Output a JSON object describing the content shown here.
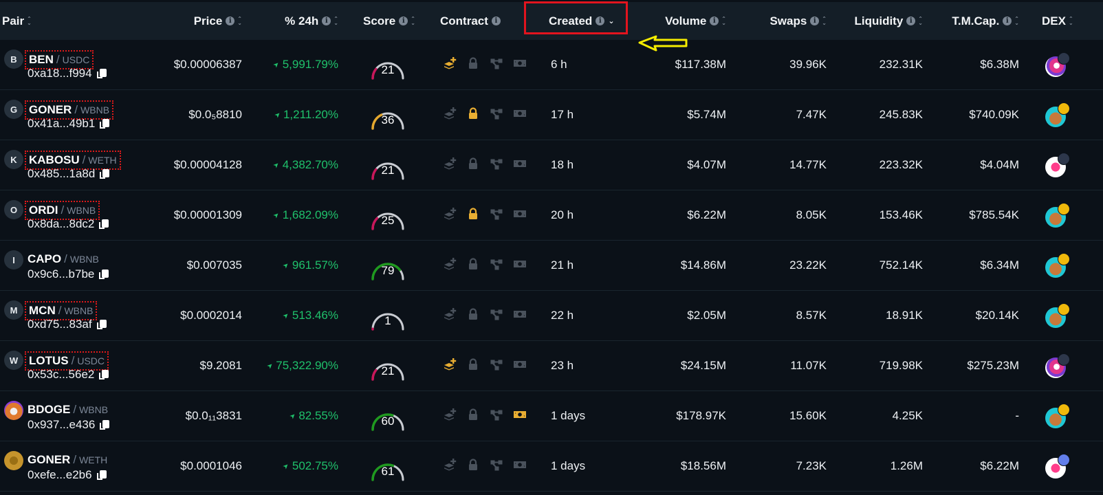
{
  "header": {
    "columns": [
      {
        "label": "Pair",
        "info": false,
        "sort": "both"
      },
      {
        "label": "Price",
        "info": true,
        "sort": "both"
      },
      {
        "label": "% 24h",
        "info": true,
        "sort": "both"
      },
      {
        "label": "Score",
        "info": true,
        "sort": "both"
      },
      {
        "label": "Contract",
        "info": true,
        "sort": "none"
      },
      {
        "label": "Created",
        "info": true,
        "sort": "desc"
      },
      {
        "label": "Volume",
        "info": true,
        "sort": "both"
      },
      {
        "label": "Swaps",
        "info": true,
        "sort": "both"
      },
      {
        "label": "Liquidity",
        "info": true,
        "sort": "both"
      },
      {
        "label": "T.M.Cap.",
        "info": true,
        "sort": "both"
      },
      {
        "label": "DEX",
        "info": false,
        "sort": "both"
      }
    ],
    "info_glyph": "i",
    "highlighted_column": "Created"
  },
  "colors": {
    "background": "#0b1118",
    "header_bg": "#141e27",
    "positive": "#1fc16b",
    "score_low": "#c8175a",
    "score_mid": "#e5a82e",
    "score_high": "#1f9a1f",
    "score_track": "#c9ccd2",
    "icon_active": "#e9ae32",
    "icon_inactive": "#4a525c",
    "annotation_red": "#e2141e",
    "annotation_yellow": "#f5ec00"
  },
  "rows": [
    {
      "avatar": "B",
      "avatar_type": "letter",
      "symbol": "BEN",
      "quote": "USDC",
      "address": "0xa18...f994",
      "dotted": true,
      "price": "$0.00006387",
      "change": "5,991.79%",
      "score": 21,
      "contract": {
        "layers": true,
        "lock": false,
        "share": false,
        "cash": false
      },
      "created": "6 h",
      "volume": "$117.38M",
      "swaps": "39.96K",
      "liquidity": "232.31K",
      "mcap": "$6.38M",
      "dex": "sushiswap",
      "chain": "arbitrum"
    },
    {
      "avatar": "G",
      "avatar_type": "letter",
      "symbol": "GONER",
      "quote": "WBNB",
      "address": "0x41a...49b1",
      "dotted": true,
      "price": "$0.0₅8810",
      "change": "1,211.20%",
      "score": 36,
      "contract": {
        "layers": false,
        "lock": true,
        "share": false,
        "cash": false
      },
      "created": "17 h",
      "volume": "$5.74M",
      "swaps": "7.47K",
      "liquidity": "245.83K",
      "mcap": "$740.09K",
      "dex": "pancakeswap",
      "chain": "bnb"
    },
    {
      "avatar": "K",
      "avatar_type": "letter",
      "symbol": "KABOSU",
      "quote": "WETH",
      "address": "0x485...1a8d",
      "dotted": true,
      "price": "$0.00004128",
      "change": "4,382.70%",
      "score": 21,
      "contract": {
        "layers": false,
        "lock": false,
        "share": false,
        "cash": false
      },
      "created": "18 h",
      "volume": "$4.07M",
      "swaps": "14.77K",
      "liquidity": "223.32K",
      "mcap": "$4.04M",
      "dex": "uniswap",
      "chain": "arbitrum"
    },
    {
      "avatar": "O",
      "avatar_type": "letter",
      "symbol": "ORDI",
      "quote": "WBNB",
      "address": "0x8da...8dc2",
      "dotted": true,
      "price": "$0.00001309",
      "change": "1,682.09%",
      "score": 25,
      "contract": {
        "layers": false,
        "lock": true,
        "share": false,
        "cash": false
      },
      "created": "20 h",
      "volume": "$6.22M",
      "swaps": "8.05K",
      "liquidity": "153.46K",
      "mcap": "$785.54K",
      "dex": "pancakeswap",
      "chain": "bnb"
    },
    {
      "avatar": "I",
      "avatar_type": "letter",
      "symbol": "CAPO",
      "quote": "WBNB",
      "address": "0x9c6...b7be",
      "dotted": false,
      "price": "$0.007035",
      "change": "961.57%",
      "score": 79,
      "contract": {
        "layers": false,
        "lock": false,
        "share": false,
        "cash": false
      },
      "created": "21 h",
      "volume": "$14.86M",
      "swaps": "23.22K",
      "liquidity": "752.14K",
      "mcap": "$6.34M",
      "dex": "pancakeswap",
      "chain": "bnb"
    },
    {
      "avatar": "M",
      "avatar_type": "letter",
      "symbol": "MCN",
      "quote": "WBNB",
      "address": "0xd75...83af",
      "dotted": true,
      "price": "$0.0002014",
      "change": "513.46%",
      "score": 1,
      "contract": {
        "layers": false,
        "lock": false,
        "share": false,
        "cash": false
      },
      "created": "22 h",
      "volume": "$2.05M",
      "swaps": "8.57K",
      "liquidity": "18.91K",
      "mcap": "$20.14K",
      "dex": "pancakeswap",
      "chain": "bnb"
    },
    {
      "avatar": "W",
      "avatar_type": "letter",
      "symbol": "LOTUS",
      "quote": "USDC",
      "address": "0x53c...56e2",
      "dotted": true,
      "price": "$9.2081",
      "change": "75,322.90%",
      "score": 21,
      "contract": {
        "layers": true,
        "lock": false,
        "share": false,
        "cash": false
      },
      "created": "23 h",
      "volume": "$24.15M",
      "swaps": "11.07K",
      "liquidity": "719.98K",
      "mcap": "$275.23M",
      "dex": "sushiswap",
      "chain": "arbitrum"
    },
    {
      "avatar": "",
      "avatar_type": "doge",
      "symbol": "BDOGE",
      "quote": "WBNB",
      "address": "0x937...e436",
      "dotted": false,
      "price": "$0.0₁₁3831",
      "change": "82.55%",
      "score": 60,
      "contract": {
        "layers": false,
        "lock": false,
        "share": false,
        "cash": true
      },
      "created": "1 days",
      "volume": "$178.97K",
      "swaps": "15.60K",
      "liquidity": "4.25K",
      "mcap": "-",
      "dex": "pancakeswap",
      "chain": "bnb"
    },
    {
      "avatar": "",
      "avatar_type": "gold",
      "symbol": "GONER",
      "quote": "WETH",
      "address": "0xefe...e2b6",
      "dotted": false,
      "price": "$0.0001046",
      "change": "502.75%",
      "score": 61,
      "contract": {
        "layers": false,
        "lock": false,
        "share": false,
        "cash": false
      },
      "created": "1 days",
      "volume": "$18.56M",
      "swaps": "7.23K",
      "liquidity": "1.26M",
      "mcap": "$6.22M",
      "dex": "uniswap",
      "chain": "ethereum"
    }
  ]
}
